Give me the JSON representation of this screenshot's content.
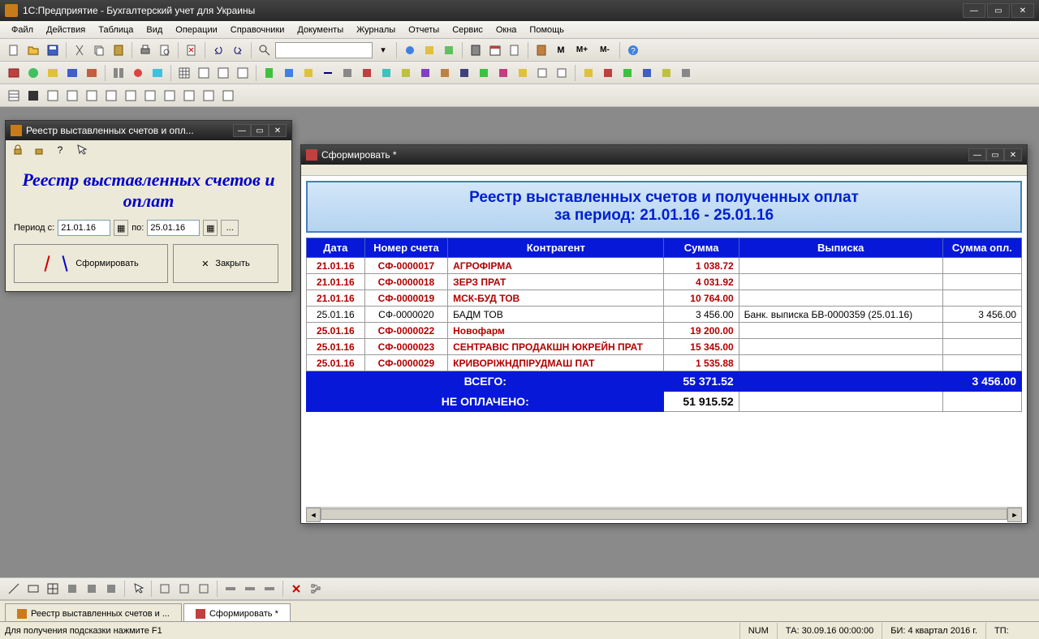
{
  "app": {
    "title": "1С:Предприятие - Бухгалтерский учет для Украины"
  },
  "menu": {
    "file": "Файл",
    "actions": "Действия",
    "table": "Таблица",
    "view": "Вид",
    "operations": "Операции",
    "references": "Справочники",
    "documents": "Документы",
    "journals": "Журналы",
    "reports": "Отчеты",
    "service": "Сервис",
    "windows": "Окна",
    "help": "Помощь"
  },
  "toolbar": {
    "m": "M",
    "mplus": "M+",
    "mminus": "M-"
  },
  "dialog": {
    "title": "Реестр выставленных счетов и опл...",
    "heading": "Реестр выставленных счетов и оплат",
    "period_from": "Период с:",
    "period_to": "по:",
    "date_from": "21.01.16",
    "date_to": "25.01.16",
    "ellipsis": "...",
    "btn_form": "Сформировать",
    "btn_close": "Закрыть"
  },
  "report": {
    "title": "Сформировать *",
    "header_line1": "Реестр выставленных счетов и полученных оплат",
    "header_line2": "за период: 21.01.16 - 25.01.16",
    "cols": {
      "date": "Дата",
      "invoice": "Номер счета",
      "party": "Контрагент",
      "sum": "Сумма",
      "statement": "Выписка",
      "paid": "Сумма опл."
    },
    "rows": [
      {
        "date": "21.01.16",
        "inv": "СФ-0000017",
        "party": "АГРОФІРМА",
        "sum": "1 038.72",
        "stmt": "",
        "paid": "",
        "unpaid": true
      },
      {
        "date": "21.01.16",
        "inv": "СФ-0000018",
        "party": "ЗЕРЗ    ПРАТ",
        "sum": "4 031.92",
        "stmt": "",
        "paid": "",
        "unpaid": true
      },
      {
        "date": "21.01.16",
        "inv": "СФ-0000019",
        "party": "МСК-БУД ТОВ",
        "sum": "10 764.00",
        "stmt": "",
        "paid": "",
        "unpaid": true
      },
      {
        "date": "25.01.16",
        "inv": "СФ-0000020",
        "party": "БАДМ ТОВ",
        "sum": "3 456.00",
        "stmt": "Банк. выписка БВ-0000359 (25.01.16)",
        "paid": "3 456.00",
        "unpaid": false
      },
      {
        "date": "25.01.16",
        "inv": "СФ-0000022",
        "party": "Новофарм",
        "sum": "19 200.00",
        "stmt": "",
        "paid": "",
        "unpaid": true
      },
      {
        "date": "25.01.16",
        "inv": "СФ-0000023",
        "party": "СЕНТРАВІС ПРОДАКШН ЮКРЕЙН ПРАТ",
        "sum": "15 345.00",
        "stmt": "",
        "paid": "",
        "unpaid": true
      },
      {
        "date": "25.01.16",
        "inv": "СФ-0000029",
        "party": "КРИВОРІЖНДПІРУДМАШ ПАТ",
        "sum": "1 535.88",
        "stmt": "",
        "paid": "",
        "unpaid": true
      }
    ],
    "totals": {
      "all_label": "ВСЕГО:",
      "all_sum": "55 371.52",
      "all_paid": "3 456.00",
      "unpaid_label": "НЕ ОПЛАЧЕНО:",
      "unpaid_sum": "51 915.52"
    }
  },
  "tabs": {
    "t1": "Реестр выставленных счетов и ...",
    "t2": "Сформировать *"
  },
  "status": {
    "hint": "Для получения подсказки нажмите F1",
    "num": "NUM",
    "ta": "ТА: 30.09.16  00:00:00",
    "bi": "БИ: 4 квартал 2016 г.",
    "tp": "ТП:"
  }
}
